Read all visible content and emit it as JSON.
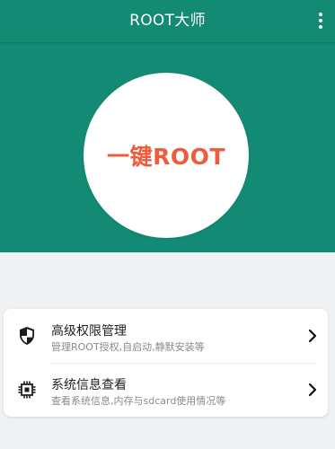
{
  "app_bar": {
    "title": "ROOT大师",
    "overflow_icon": "more-vert-icon"
  },
  "hero": {
    "button_label": "一键ROOT"
  },
  "menu": {
    "items": [
      {
        "icon": "shield-icon",
        "title": "高级权限管理",
        "subtitle": "管理ROOT授权,自启动,静默安装等"
      },
      {
        "icon": "chip-icon",
        "title": "系统信息查看",
        "subtitle": "查看系统信息,内存与sdcard使用情况等"
      }
    ]
  },
  "colors": {
    "primary": "#138a74",
    "accent": "#ef5b3c",
    "background": "#f0f1f3",
    "card": "#ffffff"
  }
}
